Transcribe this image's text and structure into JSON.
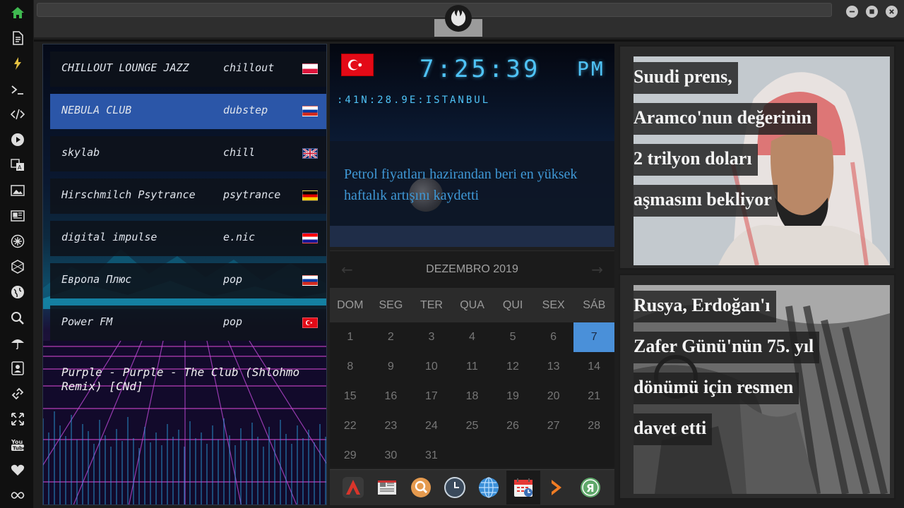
{
  "sidebar": {
    "icons": [
      "home-icon",
      "document-icon",
      "lightning-icon",
      "terminal-icon",
      "code-icon",
      "play-icon",
      "translate-icon",
      "image-icon",
      "newspaper-icon",
      "gear-badge-icon",
      "hexagon-icon",
      "globe-icon",
      "search-icon",
      "umbrella-icon",
      "contact-icon",
      "link-icon",
      "expand-icon",
      "youtube-icon",
      "heart-icon",
      "infinity-icon"
    ],
    "accent_colors": {
      "home": "#3fb950",
      "lightning": "#e3c041"
    }
  },
  "window": {
    "logo": "rebel-alliance-icon",
    "buttons": [
      "minimize-icon",
      "maximize-icon",
      "close-icon"
    ]
  },
  "radio": {
    "stations": [
      {
        "name": "CHILLOUT LOUNGE JAZZ",
        "genre": "chillout",
        "flag": "poland"
      },
      {
        "name": "NEBULA CLUB",
        "genre": "dubstep",
        "flag": "russia",
        "active": true
      },
      {
        "name": "skylab",
        "genre": "chill",
        "flag": "uk"
      },
      {
        "name": "Hirschmilch Psytrance",
        "genre": "psytrance",
        "flag": "germany"
      },
      {
        "name": "digital impulse",
        "genre": "e.nic",
        "flag": "croatia"
      },
      {
        "name": "Европа Плюс",
        "genre": "pop",
        "flag": "russia"
      },
      {
        "name": "Power FM",
        "genre": "pop",
        "flag": "turkey"
      }
    ],
    "now_playing": "Purple - Purple - The Club (Shlohmo Remix) [CNd]"
  },
  "clock": {
    "flag": "turkey",
    "time": "7:25:39",
    "ampm": "PM",
    "location": ":41N:28.9E:ISTANBUL",
    "ticker": "Petrol fiyatları hazirandan beri en yüksek haftalık artışını kaydetti",
    "accent": "#4fc3f7"
  },
  "calendar": {
    "month": "DEZEMBRO 2019",
    "weekdays": [
      "DOM",
      "SEG",
      "TER",
      "QUA",
      "QUI",
      "SEX",
      "SÁB"
    ],
    "weeks": [
      [
        "1",
        "2",
        "3",
        "4",
        "5",
        "6",
        "7"
      ],
      [
        "8",
        "9",
        "10",
        "11",
        "12",
        "13",
        "14"
      ],
      [
        "15",
        "16",
        "17",
        "18",
        "19",
        "20",
        "21"
      ],
      [
        "22",
        "23",
        "24",
        "25",
        "26",
        "27",
        "28"
      ],
      [
        "29",
        "30",
        "31",
        "",
        "",
        "",
        ""
      ]
    ],
    "today": "7",
    "today_color": "#4a90d9"
  },
  "dock": {
    "apps": [
      "arch-linux-icon",
      "news-reader-icon",
      "search-app-icon",
      "clock-app-icon",
      "globe-browser-icon",
      "calendar-app-icon",
      "forward-arrow-icon",
      "yandex-icon"
    ],
    "selected": "calendar-app-icon"
  },
  "news": {
    "cards": [
      {
        "headline_lines": [
          "Suudi prens,",
          "Aramco'nun değerinin",
          "2 trilyon doları",
          "aşmasını bekliyor"
        ]
      },
      {
        "headline_lines": [
          "Rusya, Erdoğan'ı",
          "Zafer Günü'nün 75. yıl",
          "dönümü için resmen",
          "davet etti"
        ]
      }
    ]
  }
}
